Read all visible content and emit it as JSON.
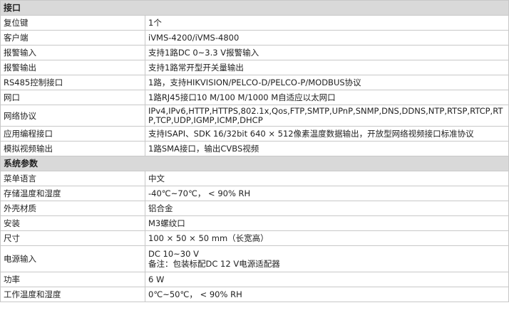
{
  "sections": [
    {
      "title": "接口",
      "rows": [
        {
          "label": "复位键",
          "value": "1个"
        },
        {
          "label": "客户端",
          "value": "iVMS-4200/iVMS-4800"
        },
        {
          "label": "报警输入",
          "value": "支持1路DC 0~3.3 V报警输入"
        },
        {
          "label": "报警输出",
          "value": "支持1路常开型开关量输出"
        },
        {
          "label": "RS485控制接口",
          "value": "1路，支持HIKVISION/PELCO-D/PELCO-P/MODBUS协议"
        },
        {
          "label": "网口",
          "value": "1路RJ45接口10 M/100 M/1000 M自适应以太网口"
        },
        {
          "label": "网络协议",
          "value": "IPv4,IPv6,HTTP,HTTPS,802.1x,Qos,FTP,SMTP,UPnP,SNMP,DNS,DDNS,NTP,RTSP,RTCP,RTP,TCP,UDP,IGMP,ICMP,DHCP"
        },
        {
          "label": "应用编程接口",
          "value": "支持ISAPI、SDK 16/32bit 640 × 512像素温度数据输出，开放型网络视频接口标准协议"
        },
        {
          "label": "模拟视频输出",
          "value": "1路SMA接口，输出CVBS视频"
        }
      ]
    },
    {
      "title": "系统参数",
      "rows": [
        {
          "label": "菜单语言",
          "value": "中文"
        },
        {
          "label": "存储温度和湿度",
          "value": "-40℃~70℃， < 90% RH"
        },
        {
          "label": "外壳材质",
          "value": "铝合金"
        },
        {
          "label": "安装",
          "value": "M3螺纹口"
        },
        {
          "label": "尺寸",
          "value": "100 × 50 × 50 mm（长宽高）"
        },
        {
          "label": "电源输入",
          "value_line1": "DC 10~30 V",
          "value_line2": "备注：包装标配DC 12 V电源适配器"
        },
        {
          "label": "功率",
          "value": "6 W"
        },
        {
          "label": "工作温度和湿度",
          "value": "0℃~50℃， < 90% RH"
        }
      ]
    }
  ]
}
